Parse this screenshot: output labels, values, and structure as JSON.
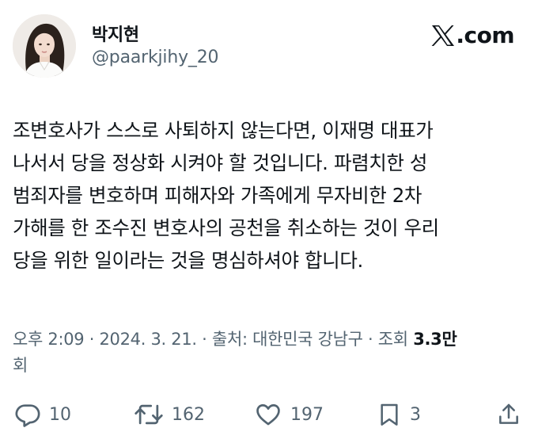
{
  "author": {
    "display_name": "박지현",
    "handle": "@paarkjihy_20"
  },
  "brand": {
    "label": ".com",
    "icon": "x-logo-icon"
  },
  "tweet": {
    "lines": [
      "조변호사가 스스로 사퇴하지 않는다면, 이재명 대표가",
      "나서서 당을 정상화 시켜야 할 것입니다. 파렴치한 성",
      "범죄자를 변호하며 피해자와 가족에게 무자비한 2차",
      "가해를 한 조수진 변호사의 공천을 취소하는 것이 우리",
      "당을 위한 일이라는 것을 명심하셔야 합니다."
    ]
  },
  "meta": {
    "line1_text": "오후 2:09 · 2024. 3. 21. · 출처: 대한민국 강남구 · 조회 ",
    "views_number": "3.3만",
    "line2_text": "회"
  },
  "actions": {
    "reply": {
      "icon": "reply-icon",
      "count": "10"
    },
    "repost": {
      "icon": "repost-icon",
      "count": "162"
    },
    "like": {
      "icon": "heart-icon",
      "count": "197"
    },
    "bookmark": {
      "icon": "bookmark-icon",
      "count": "3"
    },
    "share": {
      "icon": "share-icon"
    }
  },
  "colors": {
    "text_primary": "#0f1419",
    "text_secondary": "#536471",
    "background": "#ffffff"
  }
}
